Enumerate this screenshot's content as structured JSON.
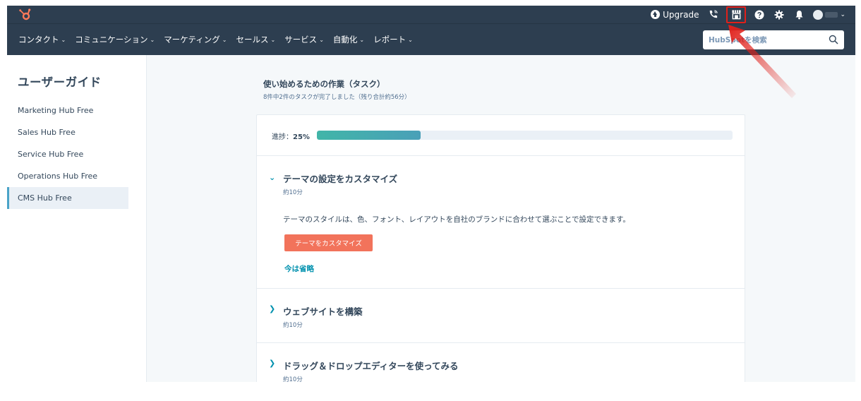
{
  "topbar": {
    "upgrade_label": "Upgrade"
  },
  "nav": {
    "items": [
      {
        "label": "コンタクト"
      },
      {
        "label": "コミュニケーション"
      },
      {
        "label": "マーケティング"
      },
      {
        "label": "セールス"
      },
      {
        "label": "サービス"
      },
      {
        "label": "自動化"
      },
      {
        "label": "レポート"
      }
    ],
    "search_placeholder": "HubSpotを検索"
  },
  "sidebar": {
    "title": "ユーザーガイド",
    "items": [
      {
        "label": "Marketing Hub Free"
      },
      {
        "label": "Sales Hub Free"
      },
      {
        "label": "Service Hub Free"
      },
      {
        "label": "Operations Hub Free"
      },
      {
        "label": "CMS Hub Free",
        "active": true
      }
    ]
  },
  "main": {
    "title": "使い始めるための作業（タスク）",
    "subtitle": "8件中2件のタスクが完了しました（残り合計約56分）",
    "progress": {
      "label": "進捗：",
      "value_text": "25%",
      "value": 0.25
    },
    "tasks": [
      {
        "title": "テーマの設定をカスタマイズ",
        "time": "約10分",
        "expanded": true,
        "description": "テーマのスタイルは、色、フォント、レイアウトを自社のブランドに合わせて選ぶことで設定できます。",
        "cta_label": "テーマをカスタマイズ",
        "skip_label": "今は省略"
      },
      {
        "title": "ウェブサイトを構築",
        "time": "約10分",
        "expanded": false
      },
      {
        "title": "ドラッグ＆ドロップエディターを使ってみる",
        "time": "約10分",
        "expanded": false
      }
    ]
  },
  "colors": {
    "topbar_bg": "#2d3e50",
    "accent_teal": "#0091ae",
    "cta_orange": "#f2735b",
    "highlight_red": "#e0201a",
    "progress_fill": "#41b5a8"
  }
}
